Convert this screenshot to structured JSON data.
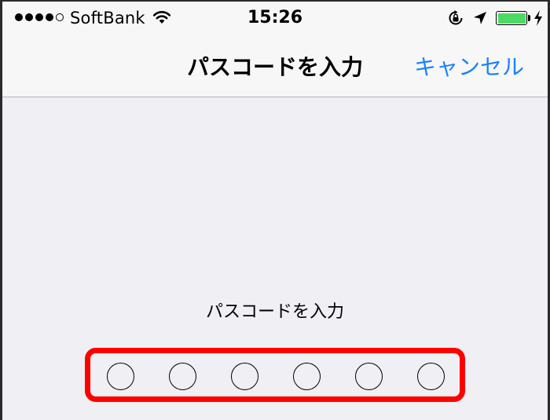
{
  "status_bar": {
    "signal_bars_filled": 4,
    "signal_bars_total": 5,
    "carrier": "SoftBank",
    "time": "15:26",
    "battery_color": "#4cd964"
  },
  "nav": {
    "title": "パスコードを入力",
    "cancel_label": "キャンセル",
    "accent_color": "#1a82fb"
  },
  "passcode": {
    "prompt": "パスコードを入力",
    "length": 6,
    "entered": 0,
    "highlight_color": "#ff0000"
  }
}
